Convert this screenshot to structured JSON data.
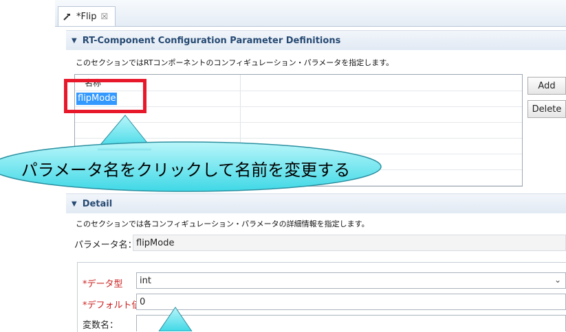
{
  "editor": {
    "tab_title": "*Flip",
    "tab_close": "☒"
  },
  "definitions": {
    "title": "RT-Component Configuration Parameter Definitions",
    "description": "このセクションではRTコンポーネントのコンフィギュレーション・パラメータを指定します。",
    "table": {
      "header_name": "名称",
      "selected_row": "flipMode"
    },
    "add_label": "Add",
    "delete_label": "Delete"
  },
  "callout": {
    "text": "パラメータ名をクリックして名前を変更する"
  },
  "detail": {
    "title": "Detail",
    "description": "このセクションでは各コンフィギュレーション・パラメータの詳細情報を指定します。",
    "param_name_label": "パラメータ名：",
    "param_name_value": "flipMode",
    "data_type_label": "*データ型",
    "data_type_value": "int",
    "default_label": "*デフォルト値",
    "default_value": "0",
    "var_name_label": "変数名："
  },
  "colors": {
    "highlight": "#e8182b",
    "selection": "#3399ff",
    "callout_fill": "#7fe9f2",
    "section_text": "#274a73"
  }
}
